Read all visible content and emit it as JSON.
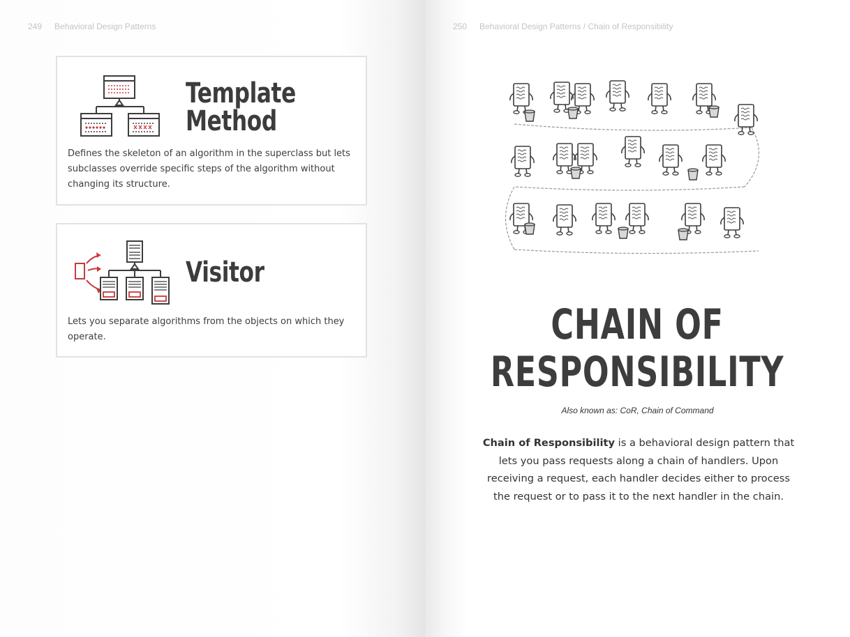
{
  "left_page": {
    "page_number": "249",
    "running_head": "Behavioral Design Patterns",
    "cards": [
      {
        "title_line1": "Template",
        "title_line2": "Method",
        "icon": "template-method-diagram-icon",
        "description": "Defines the skeleton of an algorithm in the superclass but lets subclasses override specific steps of the algorithm without changing its structure."
      },
      {
        "title_line1": "Visitor",
        "icon": "visitor-diagram-icon",
        "description": "Lets you separate algorithms from the objects on which they operate."
      }
    ]
  },
  "right_page": {
    "page_number": "250",
    "running_head": "Behavioral Design Patterns / Chain of Responsibility",
    "illustration": "chain-of-handlers-illustration",
    "title_line1": "CHAIN OF",
    "title_line2": "RESPONSIBILITY",
    "also_known_as": "Also known as: CoR, Chain of Command",
    "intro_bold": "Chain of Responsibility",
    "intro_rest": " is a behavioral design pattern that lets you pass requests along a chain of handlers. Upon receiving a request, each handler decides either to process the request or to pass it to the next handler in the chain."
  },
  "colors": {
    "accent_red": "#c8393b",
    "text_dark": "#3d3d3d",
    "running_head_gray": "#c4c4c4",
    "card_border": "#e2e2e2"
  }
}
